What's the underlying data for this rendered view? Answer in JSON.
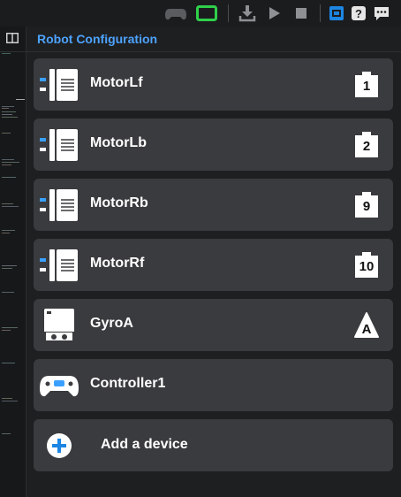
{
  "panel": {
    "title": "Robot Configuration"
  },
  "toolbar": {
    "icons": [
      "gamepad-icon",
      "brain-screen-icon",
      "download-icon",
      "play-icon",
      "stop-icon",
      "monitor-icon",
      "help-icon",
      "feedback-icon"
    ]
  },
  "colors": {
    "accent": "#4da3ff",
    "card": "#3a3b3e",
    "brain_green": "#2fd14a",
    "monitor_blue": "#1d86e3"
  },
  "devices": [
    {
      "name": "MotorLf",
      "port": "1",
      "icon": "motor-icon"
    },
    {
      "name": "MotorLb",
      "port": "2",
      "icon": "motor-icon"
    },
    {
      "name": "MotorRb",
      "port": "9",
      "icon": "motor-icon"
    },
    {
      "name": "MotorRf",
      "port": "10",
      "icon": "motor-icon"
    },
    {
      "name": "GyroA",
      "port": "A",
      "icon": "gyro-icon"
    },
    {
      "name": "Controller1",
      "icon": "controller-icon"
    }
  ],
  "add_device": {
    "label": "Add a device",
    "icon": "plus-icon"
  }
}
